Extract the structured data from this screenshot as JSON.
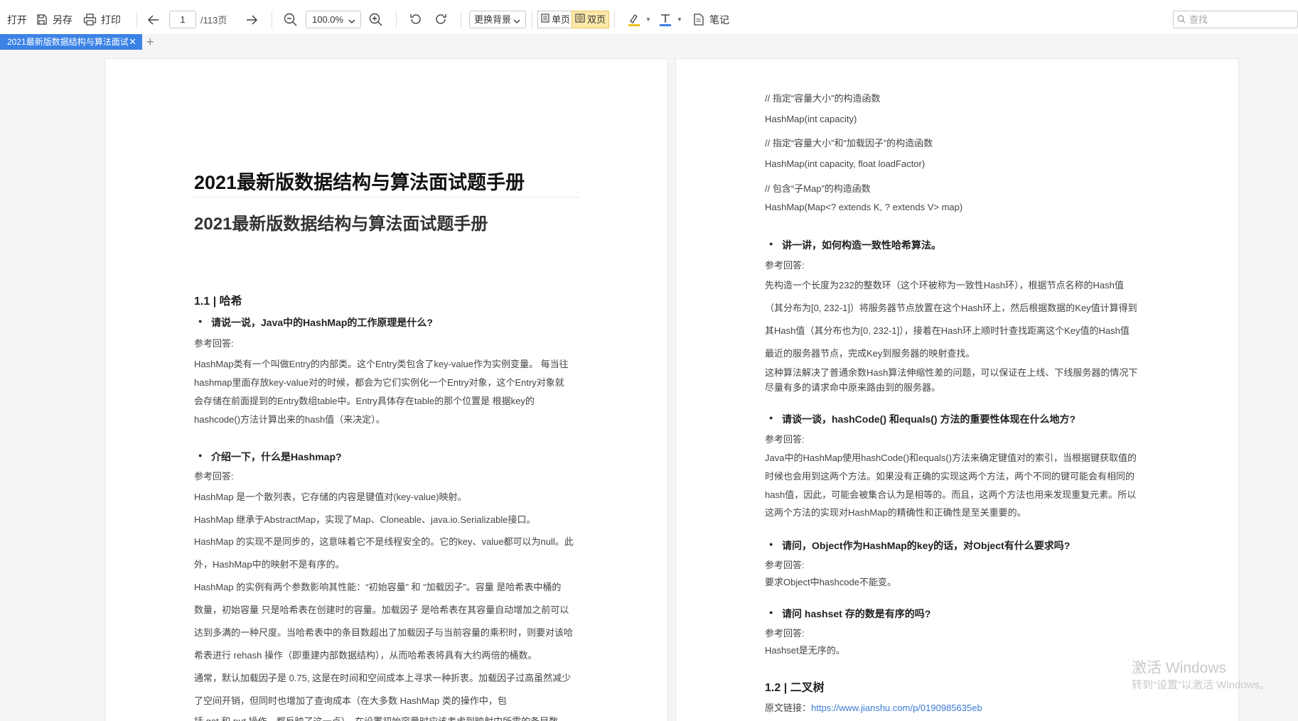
{
  "toolbar": {
    "open": "打开",
    "save_as": "另存",
    "print": "打印",
    "page_current": "1",
    "page_total": "/113页",
    "zoom": "100.0%",
    "background": "更换背景",
    "single_page": "单页",
    "double_page": "双页",
    "note": "笔记",
    "search_placeholder": "查找"
  },
  "tabs": [
    {
      "label": "2021最新版数据结构与算法面试题手册"
    }
  ],
  "left_page": {
    "title": "2021最新版数据结构与算法面试题手册",
    "subtitle": "2021最新版数据结构与算法面试题手册",
    "section": "1.1 | 哈希",
    "q1": "请说一说，Java中的HashMap的工作原理是什么?",
    "q1_label": "参考回答:",
    "q1_lines": [
      "HashMap类有一个叫做Entry的内部类。这个Entry类包含了key-value作为实例变量。 每当往",
      "hashmap里面存放key-value对的时候，都会为它们实例化一个Entry对象，这个Entry对象就",
      "会存储在前面提到的Entry数组table中。Entry具体存在table的那个位置是 根据key的",
      "hashcode()方法计算出来的hash值（来决定）。"
    ],
    "q2": "介绍一下，什么是Hashmap?",
    "q2_label": "参考回答:",
    "q2_lines": [
      "HashMap 是一个散列表，它存储的内容是键值对(key-value)映射。",
      "HashMap 继承于AbstractMap，实现了Map、Cloneable、java.io.Serializable接口。",
      "HashMap 的实现不是同步的，这意味着它不是线程安全的。它的key、value都可以为null。此",
      "外，HashMap中的映射不是有序的。",
      "HashMap 的实例有两个参数影响其性能：“初始容量” 和 “加载因子”。容量 是哈希表中桶的",
      "数量，初始容量 只是哈希表在创建时的容量。加载因子 是哈希表在其容量自动增加之前可以",
      "达到多满的一种尺度。当哈希表中的条目数超出了加载因子与当前容量的乘积时，则要对该哈",
      "希表进行 rehash 操作（即重建内部数据结构），从而哈希表将具有大约两倍的桶数。",
      "通常，默认加载因子是 0.75, 这是在时间和空间成本上寻求一种折衷。加载因子过高虽然减少",
      "了空间开销，但同时也增加了查询成本（在大多数 HashMap 类的操作中，包",
      "括 get 和 put 操作，都反映了这一点）。在设置初始容量时应该考虑到映射中所需的条目数"
    ]
  },
  "right_page": {
    "code_lines": [
      "// 指定“容量大小”的构造函数",
      "HashMap(int capacity)",
      "// 指定“容量大小”和“加载因子”的构造函数",
      "HashMap(int capacity, float loadFactor)",
      "// 包含“子Map”的构造函数",
      "HashMap(Map<? extends K, ? extends V> map)"
    ],
    "q3": "讲一讲，如何构造一致性哈希算法。",
    "q3_label": "参考回答:",
    "q3_lines": [
      "先构造一个长度为232的整数环（这个环被称为一致性Hash环），根据节点名称的Hash值",
      "（其分布为[0, 232-1]）将服务器节点放置在这个Hash环上，然后根据数据的Key值计算得到",
      "其Hash值（其分布也为[0, 232-1]），接着在Hash环上顺时针查找距离这个Key值的Hash值",
      "最近的服务器节点，完成Key到服务器的映射查找。",
      "这种算法解决了普通余数Hash算法伸缩性差的问题，可以保证在上线、下线服务器的情况下",
      "尽量有多的请求命中原来路由到的服务器。"
    ],
    "q4": "请谈一谈，hashCode() 和equals() 方法的重要性体现在什么地方?",
    "q4_label": "参考回答:",
    "q4_lines": [
      "Java中的HashMap使用hashCode()和equals()方法来确定键值对的索引，当根据键获取值的",
      "时候也会用到这两个方法。如果没有正确的实现这两个方法，两个不同的键可能会有相同的",
      "hash值，因此，可能会被集合认为是相等的。而且，这两个方法也用来发现重复元素。所以",
      "这两个方法的实现对HashMap的精确性和正确性是至关重要的。"
    ],
    "q5": "请问，Object作为HashMap的key的话，对Object有什么要求吗?",
    "q5_label": "参考回答:",
    "q5_lines": [
      "要求Object中hashcode不能变。"
    ],
    "q6": "请问 hashset 存的数是有序的吗?",
    "q6_label": "参考回答:",
    "q6_lines": [
      "Hashset是无序的。"
    ],
    "section": "1.2 | 二叉树",
    "link_label": "原文链接：",
    "link_url": "https://www.jianshu.com/p/0190985635eb"
  },
  "watermark": {
    "line1": "激活 Windows",
    "line2": "转到“设置”以激活 Windows。"
  }
}
